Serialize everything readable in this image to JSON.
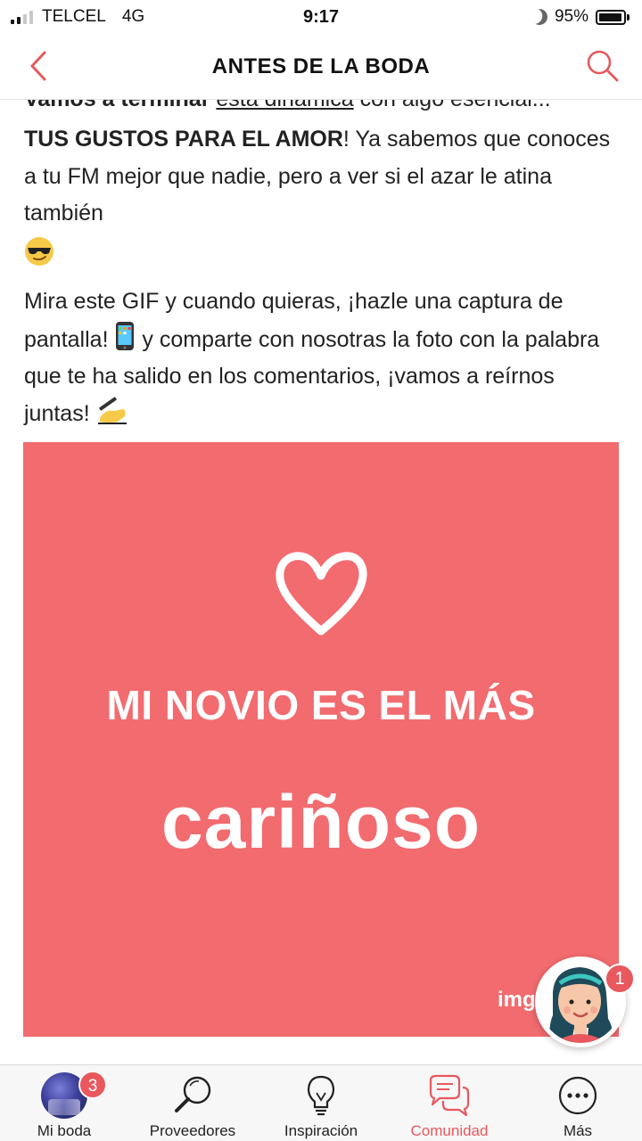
{
  "status_bar": {
    "carrier": "TELCEL",
    "network": "4G",
    "time": "9:17",
    "battery": "95%",
    "battery_level": 0.95
  },
  "header": {
    "title": "ANTES DE LA BODA",
    "back_icon": "chevron-left-icon",
    "search_icon": "search-icon",
    "accent_color": "#e8585d"
  },
  "post": {
    "cut_line_start": "Vamos a terminar ",
    "cut_line_link": "esta dinámica",
    "cut_line_end": " con algo esencial...",
    "para1_bold": "TUS GUSTOS PARA EL AMOR",
    "para1_rest": "! Ya sabemos que conoces a tu FM mejor que nadie, pero a ver si el azar le atina también",
    "para2_part1": "Mira este GIF y cuando quieras, ¡hazle una captura de pantalla! ",
    "para2_part2": " y comparte con nosotras la foto con la palabra que te ha salido en los comentarios, ¡vamos a reírnos juntas! ",
    "gif": {
      "line1": "MI NOVIO ES EL MÁS",
      "line2": "cariñoso",
      "watermark": "img",
      "background_color": "#f26b6f"
    }
  },
  "assistant": {
    "badge": "1"
  },
  "bottom_nav": {
    "items": [
      {
        "label": "Mi boda",
        "icon": "avatar",
        "badge": "3"
      },
      {
        "label": "Proveedores",
        "icon": "magnifier-icon"
      },
      {
        "label": "Inspiración",
        "icon": "lightbulb-icon"
      },
      {
        "label": "Comunidad",
        "icon": "chat-bubbles-icon",
        "active": true
      },
      {
        "label": "Más",
        "icon": "more-dots-icon"
      }
    ]
  }
}
